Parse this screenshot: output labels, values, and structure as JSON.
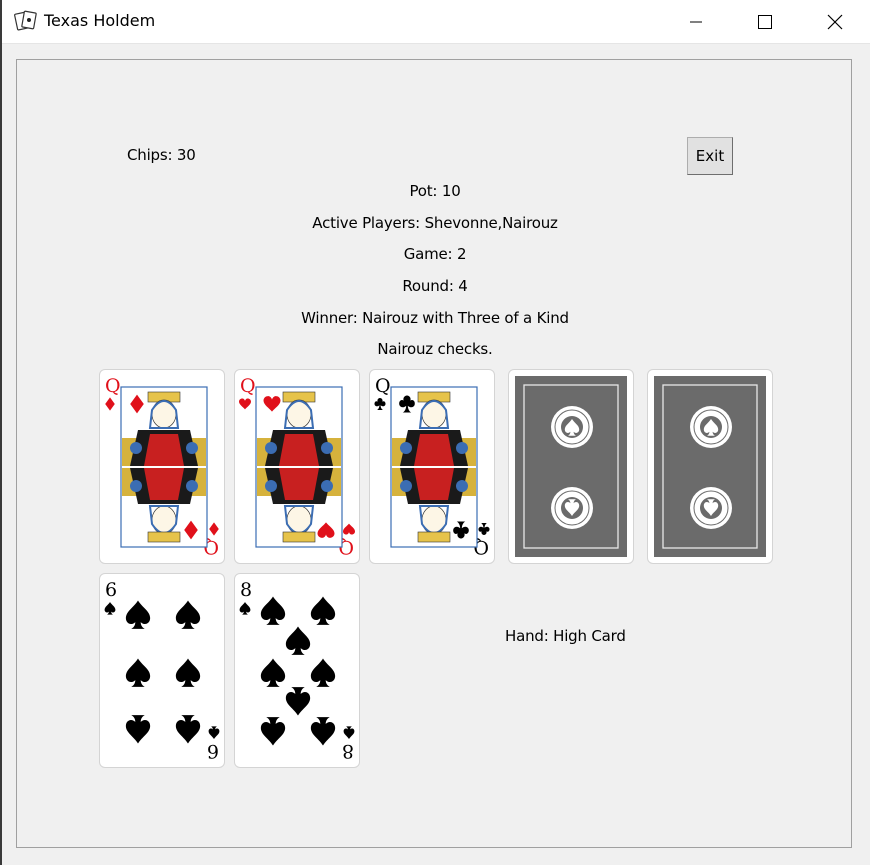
{
  "window": {
    "title": "Texas Holdem",
    "controls": [
      "minimize",
      "maximize",
      "close"
    ]
  },
  "status": {
    "chips": "Chips: 30",
    "pot": "Pot: 10",
    "active_players": "Active Players: Shevonne,Nairouz",
    "game": "Game: 2",
    "round": "Round: 4",
    "winner": "Winner: Nairouz with Three of a Kind",
    "last_action": "Nairouz checks.",
    "hand": "Hand: High Card"
  },
  "buttons": {
    "exit": "Exit"
  },
  "community_cards": [
    {
      "rank": "Q",
      "suit": "diamonds",
      "face_up": true
    },
    {
      "rank": "Q",
      "suit": "hearts",
      "face_up": true
    },
    {
      "rank": "Q",
      "suit": "clubs",
      "face_up": true
    },
    {
      "face_up": false
    },
    {
      "face_up": false
    }
  ],
  "player_cards": [
    {
      "rank": "6",
      "suit": "spades",
      "face_up": true
    },
    {
      "rank": "8",
      "suit": "spades",
      "face_up": true
    }
  ],
  "colors": {
    "red_suit": "#e0101a",
    "black_suit": "#000000",
    "card_back": "#6b6b6b"
  }
}
